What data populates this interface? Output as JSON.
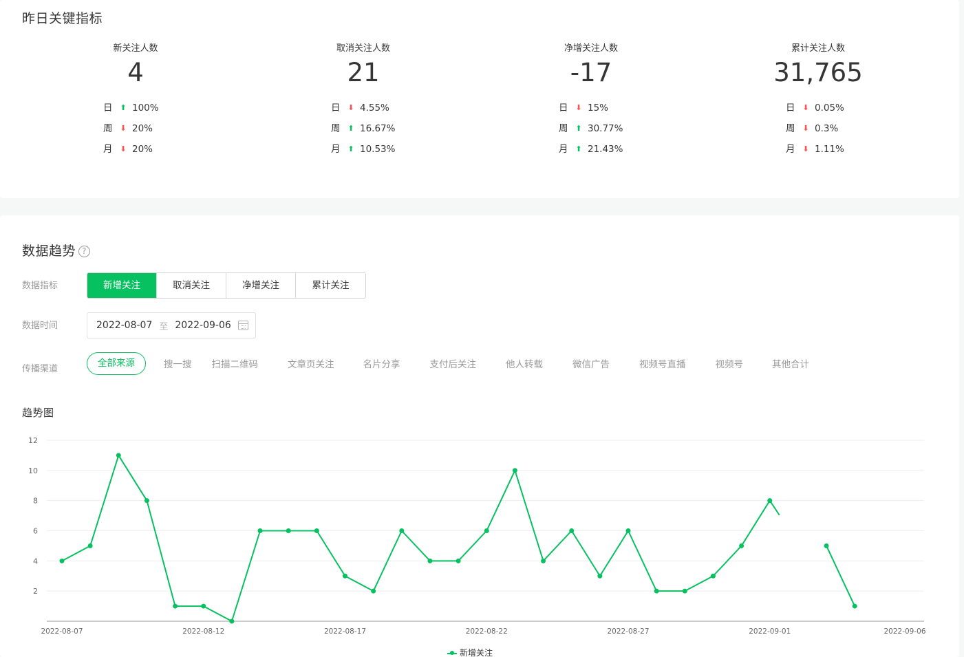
{
  "summary": {
    "title": "昨日关键指标",
    "kpis": [
      {
        "label": "新关注人数",
        "value": "4",
        "rows": [
          {
            "period": "日",
            "trend": "up",
            "pct": "100%"
          },
          {
            "period": "周",
            "trend": "down",
            "pct": "20%"
          },
          {
            "period": "月",
            "trend": "down",
            "pct": "20%"
          }
        ]
      },
      {
        "label": "取消关注人数",
        "value": "21",
        "rows": [
          {
            "period": "日",
            "trend": "down",
            "pct": "4.55%"
          },
          {
            "period": "周",
            "trend": "up",
            "pct": "16.67%"
          },
          {
            "period": "月",
            "trend": "up",
            "pct": "10.53%"
          }
        ]
      },
      {
        "label": "净增关注人数",
        "value": "-17",
        "rows": [
          {
            "period": "日",
            "trend": "down",
            "pct": "15%"
          },
          {
            "period": "周",
            "trend": "up",
            "pct": "30.77%"
          },
          {
            "period": "月",
            "trend": "up",
            "pct": "21.43%"
          }
        ]
      },
      {
        "label": "累计关注人数",
        "value": "31,765",
        "rows": [
          {
            "period": "日",
            "trend": "down",
            "pct": "0.05%"
          },
          {
            "period": "周",
            "trend": "down",
            "pct": "0.3%"
          },
          {
            "period": "月",
            "trend": "down",
            "pct": "1.11%"
          }
        ]
      }
    ]
  },
  "trend": {
    "title": "数据趋势",
    "help_icon": "?",
    "metric_label": "数据指标",
    "metric_tabs": [
      "新增关注",
      "取消关注",
      "净增关注",
      "累计关注"
    ],
    "metric_active": 0,
    "time_label": "数据时间",
    "date_start": "2022-08-07",
    "date_sep": "至",
    "date_end": "2022-09-06",
    "channel_label": "传播渠道",
    "channels": [
      "全部来源",
      "搜一搜",
      "扫描二维码",
      "文章页关注",
      "名片分享",
      "支付后关注",
      "他人转载",
      "微信广告",
      "视频号直播",
      "视频号",
      "其他合计"
    ],
    "channel_active": 0,
    "chart_title": "趋势图"
  },
  "colors": {
    "accent": "#07c160",
    "up": "#07c160",
    "down": "#fa5151",
    "grid": "#eeeeee",
    "axis": "#cccccc"
  },
  "icons": {
    "up": "arrow-up-icon",
    "down": "arrow-down-icon",
    "calendar": "calendar-icon",
    "help": "help-circle-icon"
  },
  "chart_data": {
    "type": "line",
    "x": [
      "2022-08-07",
      "2022-08-08",
      "2022-08-09",
      "2022-08-10",
      "2022-08-11",
      "2022-08-12",
      "2022-08-13",
      "2022-08-14",
      "2022-08-15",
      "2022-08-16",
      "2022-08-17",
      "2022-08-18",
      "2022-08-19",
      "2022-08-20",
      "2022-08-21",
      "2022-08-22",
      "2022-08-23",
      "2022-08-24",
      "2022-08-25",
      "2022-08-26",
      "2022-08-27",
      "2022-08-28",
      "2022-08-29",
      "2022-08-30",
      "2022-08-31",
      "2022-09-01",
      "2022-09-02",
      "2022-09-03",
      "2022-09-04"
    ],
    "x_ticks": [
      "2022-08-07",
      "2022-08-12",
      "2022-08-17",
      "2022-08-22",
      "2022-08-27",
      "2022-09-01",
      "2022-09-06"
    ],
    "y_ticks": [
      2,
      4,
      6,
      8,
      10,
      12
    ],
    "ylim": [
      0,
      12
    ],
    "series": [
      {
        "name": "新增关注",
        "values": [
          4,
          5,
          11,
          8,
          1,
          1,
          0,
          6,
          6,
          6,
          3,
          2,
          6,
          4,
          4,
          6,
          10,
          4,
          6,
          3,
          6,
          2,
          2,
          3,
          5,
          8,
          null,
          5,
          1
        ]
      }
    ],
    "grid": true,
    "legend": "bottom-center"
  }
}
